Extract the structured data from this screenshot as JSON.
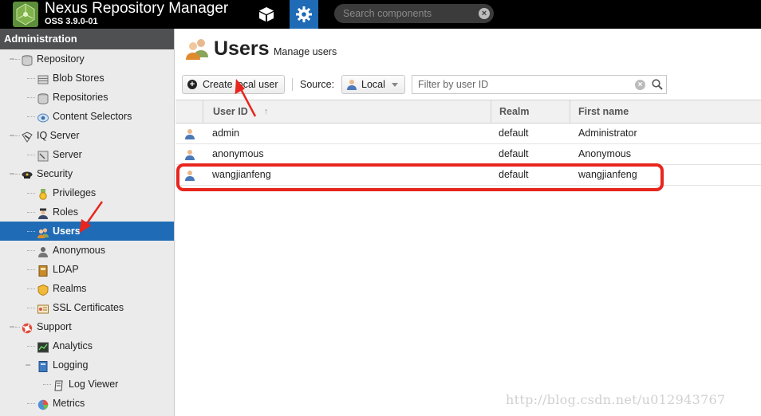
{
  "header": {
    "title": "Nexus Repository Manager",
    "version": "OSS 3.9.0-01",
    "search_placeholder": "Search components",
    "nav": [
      {
        "icon": "browse-cube-icon"
      },
      {
        "icon": "administration-gear-icon"
      }
    ]
  },
  "sidebar": {
    "title": "Administration",
    "items": [
      {
        "label": "Repository",
        "icon": "database-icon"
      },
      {
        "label": "Blob Stores",
        "icon": "blob-store-icon"
      },
      {
        "label": "Repositories",
        "icon": "database-icon"
      },
      {
        "label": "Content Selectors",
        "icon": "content-selector-icon"
      },
      {
        "label": "IQ Server",
        "icon": "iq-server-icon"
      },
      {
        "label": "Server",
        "icon": "server-icon"
      },
      {
        "label": "Security",
        "icon": "police-hat-icon"
      },
      {
        "label": "Privileges",
        "icon": "medal-icon"
      },
      {
        "label": "Roles",
        "icon": "officer-icon"
      },
      {
        "label": "Users",
        "icon": "users-icon"
      },
      {
        "label": "Anonymous",
        "icon": "anonymous-icon"
      },
      {
        "label": "LDAP",
        "icon": "address-book-icon"
      },
      {
        "label": "Realms",
        "icon": "shield-icon"
      },
      {
        "label": "SSL Certificates",
        "icon": "certificate-icon"
      },
      {
        "label": "Support",
        "icon": "lifebuoy-icon"
      },
      {
        "label": "Analytics",
        "icon": "analytics-icon"
      },
      {
        "label": "Logging",
        "icon": "book-icon"
      },
      {
        "label": "Log Viewer",
        "icon": "log-viewer-icon"
      },
      {
        "label": "Metrics",
        "icon": "pie-chart-icon"
      }
    ]
  },
  "main": {
    "title": "Users",
    "subtitle": "Manage users",
    "toolbar": {
      "create_label": "Create local user",
      "source_label": "Source:",
      "source_value": "Local",
      "filter_placeholder": "Filter by user ID"
    },
    "columns": [
      "User ID",
      "Realm",
      "First name"
    ],
    "rows": [
      {
        "user_id": "admin",
        "realm": "default",
        "first_name": "Administrator"
      },
      {
        "user_id": "anonymous",
        "realm": "default",
        "first_name": "Anonymous"
      },
      {
        "user_id": "wangjianfeng",
        "realm": "default",
        "first_name": "wangjianfeng"
      }
    ]
  },
  "watermark": "http://blog.csdn.net/u012943767",
  "colors": {
    "topbar": "#000000",
    "accent": "#1f6bb5",
    "annotation": "#e8261e"
  }
}
